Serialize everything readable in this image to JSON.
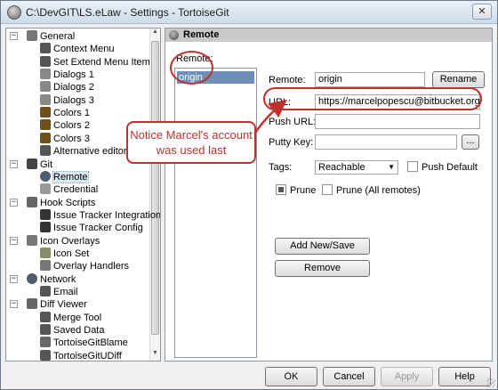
{
  "window": {
    "title": "C:\\DevGIT\\LS.eLaw - Settings - TortoiseGit",
    "close_label": "✕"
  },
  "tree": {
    "items": [
      {
        "label": "General",
        "icon": "wrench-icon",
        "expander": "−"
      },
      {
        "label": "Context Menu",
        "icon": "gear-icon"
      },
      {
        "label": "Set Extend Menu Item",
        "icon": "gear-icon"
      },
      {
        "label": "Dialogs 1",
        "icon": "dialogs-icon"
      },
      {
        "label": "Dialogs 2",
        "icon": "dialogs-icon"
      },
      {
        "label": "Dialogs 3",
        "icon": "dialogs-icon"
      },
      {
        "label": "Colors 1",
        "icon": "brush-icon"
      },
      {
        "label": "Colors 2",
        "icon": "brush-icon"
      },
      {
        "label": "Colors 3",
        "icon": "brush-icon"
      },
      {
        "label": "Alternative editor",
        "icon": "magnifier-icon"
      },
      {
        "label": "Git",
        "icon": "git-icon",
        "expander": "−"
      },
      {
        "label": "Remote",
        "icon": "globe-icon"
      },
      {
        "label": "Credential",
        "icon": "key-icon"
      },
      {
        "label": "Hook Scripts",
        "icon": "hook-icon",
        "expander": "−"
      },
      {
        "label": "Issue Tracker Integration",
        "icon": "bug-icon"
      },
      {
        "label": "Issue Tracker Config",
        "icon": "bug-icon"
      },
      {
        "label": "Icon Overlays",
        "icon": "overlay-icon",
        "expander": "−"
      },
      {
        "label": "Icon Set",
        "icon": "iconset-icon"
      },
      {
        "label": "Overlay Handlers",
        "icon": "overlay-icon"
      },
      {
        "label": "Network",
        "icon": "network-icon",
        "expander": "−"
      },
      {
        "label": "Email",
        "icon": "at-icon"
      },
      {
        "label": "Diff Viewer",
        "icon": "diff-icon",
        "expander": "−"
      },
      {
        "label": "Merge Tool",
        "icon": "merge-icon"
      },
      {
        "label": "Saved Data",
        "icon": "gear-icon"
      },
      {
        "label": "TortoiseGitBlame",
        "icon": "blame-icon"
      },
      {
        "label": "TortoiseGitUDiff",
        "icon": "udiff-icon"
      }
    ]
  },
  "page": {
    "header": "Remote",
    "remote_list_label": "Remote:",
    "remotes": [
      "origin"
    ],
    "remote_label": "Remote:",
    "remote_value": "origin",
    "rename_label": "Rename",
    "url_label": "URL:",
    "url_value": "https://marcelpopescu@bitbucket.org/legality-",
    "push_url_label": "Push URL:",
    "push_url_value": "",
    "putty_key_label": "Putty Key:",
    "putty_key_value": "",
    "browse_label": "...",
    "tags_label": "Tags:",
    "tags_value": "Reachable",
    "push_default_label": "Push Default",
    "prune_label": "Prune",
    "prune_all_label": "Prune (All remotes)",
    "add_save_label": "Add New/Save",
    "remove_label": "Remove"
  },
  "annotation": {
    "callout_text": "Notice Marcel's account was used last",
    "color": "#c0302f"
  },
  "footer": {
    "ok_label": "OK",
    "cancel_label": "Cancel",
    "apply_label": "Apply",
    "help_label": "Help"
  }
}
